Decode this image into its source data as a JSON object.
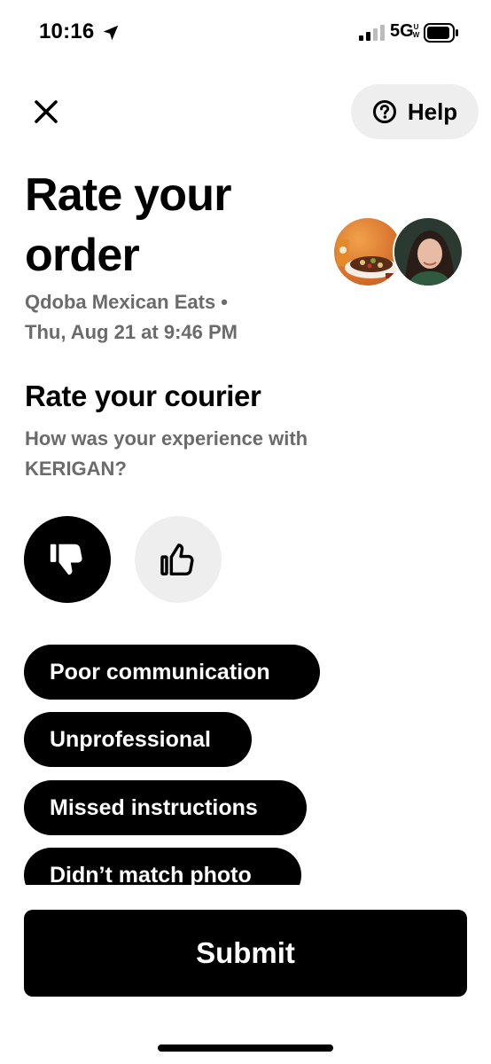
{
  "status_bar": {
    "time": "10:16",
    "network": "5G",
    "network_badge": "UW",
    "location_icon": "location-arrow-icon",
    "signal_icon": "signal-bars-icon",
    "battery_icon": "battery-icon"
  },
  "header": {
    "close_icon": "close-icon",
    "help_label": "Help",
    "help_icon": "question-circle-icon"
  },
  "order": {
    "title": "Rate your order",
    "restaurant": "Qdoba Mexican Eats •",
    "datetime": "Thu, Aug 21 at 9:46 PM",
    "restaurant_avatar": "food-bowl-image",
    "courier_avatar": "courier-photo"
  },
  "courier": {
    "title": "Rate your courier",
    "question": "How was your experience with KERIGAN?",
    "rating": "thumbs-down",
    "thumbs_down_icon": "thumbs-down-icon",
    "thumbs_up_icon": "thumbs-up-icon"
  },
  "feedback_chips": [
    {
      "label": "Poor communication"
    },
    {
      "label": "Unprofessional"
    },
    {
      "label": "Missed instructions"
    },
    {
      "label": "Didn’t match photo"
    }
  ],
  "submit_label": "Submit",
  "colors": {
    "primary": "#000000",
    "secondary_bg": "#eeeeee",
    "muted_text": "#6b6b6b"
  }
}
